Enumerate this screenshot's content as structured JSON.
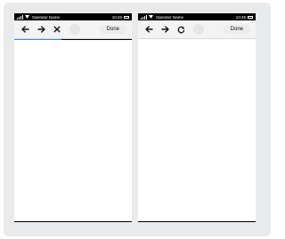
{
  "left_screen": {
    "status_bar": {
      "operator": "Operator Name",
      "time": "10:45"
    },
    "toolbar": {
      "back_icon": "arrow-left-icon",
      "forward_icon": "arrow-right-icon",
      "stop_icon": "close-icon",
      "done_label": "Done"
    },
    "load_progress": 0.4
  },
  "right_screen": {
    "status_bar": {
      "operator": "Operator Name",
      "time": "10:45"
    },
    "toolbar": {
      "back_icon": "arrow-left-icon",
      "forward_icon": "arrow-right-icon",
      "reload_icon": "reload-icon",
      "done_label": "Done"
    }
  },
  "colors": {
    "canvas": "#e9eaec",
    "progress": "#2f8fe8",
    "toolbar": "#f3f3f3"
  }
}
